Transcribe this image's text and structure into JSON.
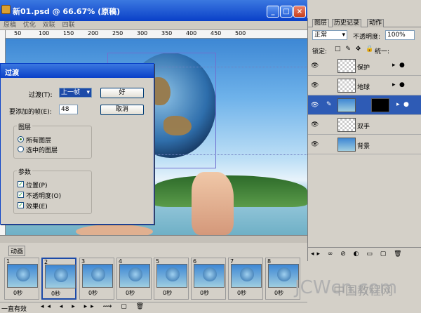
{
  "document": {
    "title": "新01.psd @ 66.67% (原稿)",
    "view_tabs": [
      "原稿",
      "优化",
      "双联",
      "四联"
    ],
    "ruler_marks": [
      "50",
      "100",
      "150",
      "200",
      "250",
      "300",
      "350",
      "400",
      "450",
      "500"
    ]
  },
  "tween_dialog": {
    "title": "过渡",
    "tween_with_label": "过渡(T):",
    "tween_with_value": "上一帧",
    "frames_to_add_label": "要添加的帧(E):",
    "frames_to_add_value": "48",
    "ok_label": "好",
    "cancel_label": "取消",
    "layers_group_label": "图层",
    "layers_options": [
      {
        "label": "所有图层",
        "selected": true
      },
      {
        "label": "选中的图层",
        "selected": false
      }
    ],
    "params_group_label": "参数",
    "params_options": [
      {
        "label": "位置(P)",
        "checked": true
      },
      {
        "label": "不透明度(O)",
        "checked": true
      },
      {
        "label": "效果(E)",
        "checked": true
      }
    ]
  },
  "layers_panel": {
    "tabs": [
      "图层",
      "历史记录",
      "动作"
    ],
    "blend_mode": "正常",
    "opacity_label": "不透明度:",
    "opacity_value": "100%",
    "lock_label": "锁定:",
    "unify_label": "统一:",
    "layers": [
      {
        "name": "保护",
        "selected": false
      },
      {
        "name": "地球",
        "selected": false
      },
      {
        "name": "",
        "selected": true
      },
      {
        "name": "双手",
        "selected": false
      },
      {
        "name": "背景",
        "selected": false
      }
    ]
  },
  "animation_panel": {
    "title": "动画",
    "frames": [
      {
        "number": "1",
        "delay": "0秒"
      },
      {
        "number": "2",
        "delay": "0秒"
      },
      {
        "number": "3",
        "delay": "0秒"
      },
      {
        "number": "4",
        "delay": "0秒"
      },
      {
        "number": "5",
        "delay": "0秒"
      },
      {
        "number": "6",
        "delay": "0秒"
      },
      {
        "number": "7",
        "delay": "0秒"
      },
      {
        "number": "8",
        "delay": "0秒"
      }
    ],
    "loop_label": "一直有效"
  },
  "watermark": {
    "brand": "JCWcn.com",
    "cn": "中国教程网"
  },
  "colors": {
    "title_bar": "#0a40c8",
    "selected_layer": "#2e5bb5",
    "window_bg": "#d4d0c8"
  }
}
